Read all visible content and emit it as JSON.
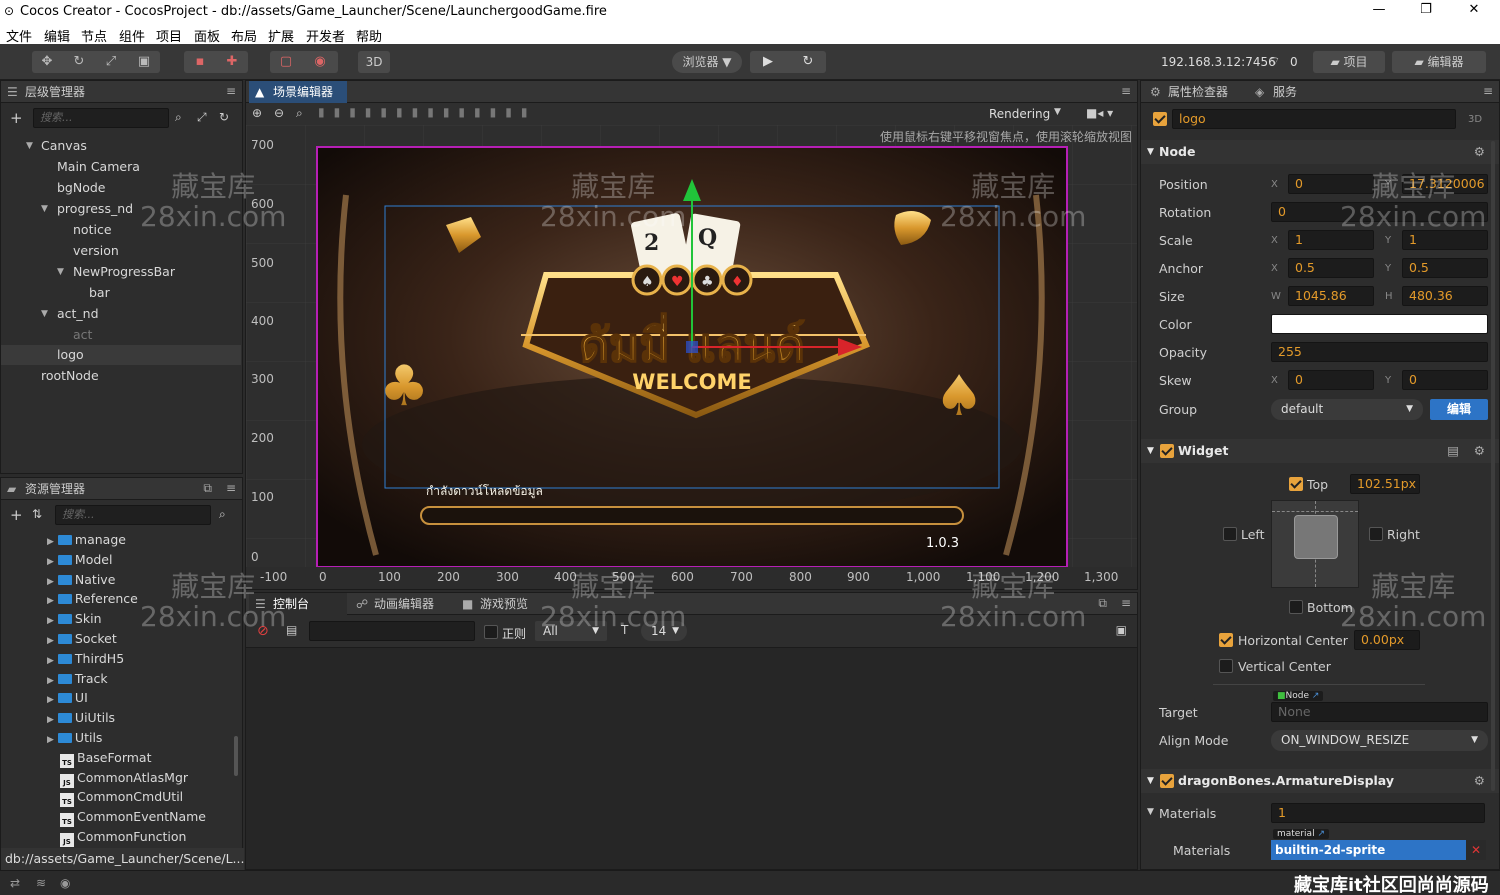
{
  "window": {
    "title": "Cocos Creator - CocosProject - db://assets/Game_Launcher/Scene/LaunchergoodGame.fire"
  },
  "menu": [
    "文件",
    "编辑",
    "节点",
    "组件",
    "项目",
    "面板",
    "布局",
    "扩展",
    "开发者",
    "帮助"
  ],
  "toolbar": {
    "mode3d": "3D",
    "browser": "浏览器 ▼",
    "ip": "192.168.3.12:7456",
    "ip_count": "0",
    "project_btn": "项目",
    "editor_btn": "编辑器"
  },
  "hierarchy": {
    "title": "层级管理器",
    "search_placeholder": "搜索...",
    "nodes": [
      "Canvas",
      "Main Camera",
      "bgNode",
      "progress_nd",
      "notice",
      "version",
      "NewProgressBar",
      "bar",
      "act_nd",
      "act",
      "logo",
      "rootNode"
    ]
  },
  "assets": {
    "title": "资源管理器",
    "search_placeholder": "搜索...",
    "items": [
      {
        "name": "manage",
        "kind": "folder"
      },
      {
        "name": "Model",
        "kind": "folder"
      },
      {
        "name": "Native",
        "kind": "folder"
      },
      {
        "name": "Reference",
        "kind": "folder"
      },
      {
        "name": "Skin",
        "kind": "folder"
      },
      {
        "name": "Socket",
        "kind": "folder"
      },
      {
        "name": "ThirdH5",
        "kind": "folder"
      },
      {
        "name": "Track",
        "kind": "folder"
      },
      {
        "name": "UI",
        "kind": "folder"
      },
      {
        "name": "UiUtils",
        "kind": "folder"
      },
      {
        "name": "Utils",
        "kind": "folder"
      },
      {
        "name": "BaseFormat",
        "kind": "TS"
      },
      {
        "name": "CommonAtlasMgr",
        "kind": "JS"
      },
      {
        "name": "CommonCmdUtil",
        "kind": "TS"
      },
      {
        "name": "CommonEventName",
        "kind": "TS"
      },
      {
        "name": "CommonFunction",
        "kind": "JS"
      }
    ],
    "path": "db://assets/Game_Launcher/Scene/L..."
  },
  "scene": {
    "title": "场景编辑器",
    "rendering": "Rendering",
    "hint": "使用鼠标右键平移视窗焦点，使用滚轮缩放视图",
    "y_ticks": [
      "700",
      "600",
      "500",
      "400",
      "300",
      "200",
      "100",
      "0"
    ],
    "x_ticks": [
      "-100",
      "0",
      "100",
      "200",
      "300",
      "400",
      "500",
      "600",
      "700",
      "800",
      "900",
      "1,000",
      "1,100",
      "1,200",
      "1,300"
    ],
    "loading_text": "กำลังดาวน์โหลดข้อมูล",
    "version_text": "1.0.3",
    "logo_title": "ดัมมี่ แลนด์",
    "logo_welcome": "WELCOME",
    "card_a": "2",
    "card_b": "Q"
  },
  "console": {
    "tabs": [
      "控制台",
      "动画编辑器",
      "游戏预览"
    ],
    "regex_label": "正则",
    "level": "All",
    "font_size": "14"
  },
  "inspector": {
    "tabs": [
      "属性检查器",
      "服务"
    ],
    "node_name": "logo",
    "badge_3d": "3D",
    "node_section": "Node",
    "props": {
      "position_label": "Position",
      "position_x": "0",
      "position_y": "17.3120006",
      "rotation_label": "Rotation",
      "rotation": "0",
      "scale_label": "Scale",
      "scale_x": "1",
      "scale_y": "1",
      "anchor_label": "Anchor",
      "anchor_x": "0.5",
      "anchor_y": "0.5",
      "size_label": "Size",
      "size_w": "1045.86",
      "size_h": "480.36",
      "color_label": "Color",
      "color_value": "#ffffff",
      "opacity_label": "Opacity",
      "opacity": "255",
      "skew_label": "Skew",
      "skew_x": "0",
      "skew_y": "0",
      "group_label": "Group",
      "group": "default",
      "edit_btn": "编辑"
    },
    "axis": {
      "x": "X",
      "y": "Y",
      "w": "W",
      "h": "H"
    },
    "widget": {
      "section": "Widget",
      "top": "Top",
      "top_value": "102.51px",
      "left": "Left",
      "right": "Right",
      "bottom": "Bottom",
      "hcenter": "Horizontal Center",
      "hcenter_value": "0.00px",
      "vcenter": "Vertical Center",
      "target_label": "Target",
      "target_badge": "Node",
      "target_value": "None",
      "align_label": "Align Mode",
      "align_value": "ON_WINDOW_RESIZE"
    },
    "dragon": {
      "section": "dragonBones.ArmatureDisplay",
      "materials_label": "Materials",
      "materials_count": "1",
      "materials_item_label": "Materials",
      "material_badge": "material",
      "material_value": "builtin-2d-sprite"
    }
  },
  "watermark": {
    "cn": "藏宝库",
    "en": "28xin.com",
    "bottom": "藏宝库it社区回尚尚源码"
  }
}
